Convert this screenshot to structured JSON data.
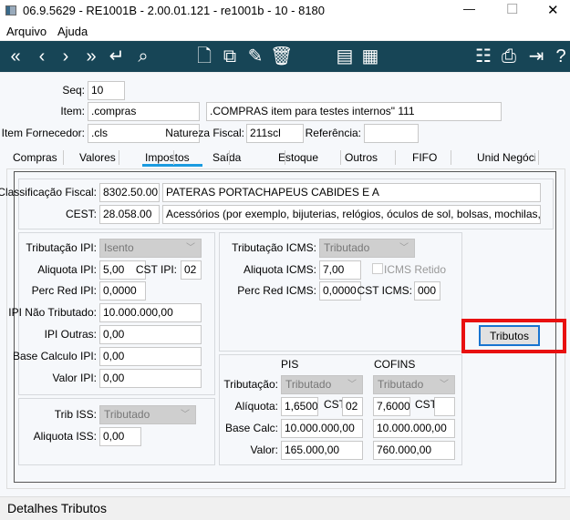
{
  "window": {
    "title": "06.9.5629 - RE1001B - 2.00.01.121 - re1001b - 10 - 8180",
    "minimize": "—",
    "maximize": "☐",
    "close": "✕"
  },
  "menu": [
    "Arquivo",
    "Ajuda"
  ],
  "toolbar": {
    "icons": [
      "first-icon",
      "prev-icon",
      "next-icon",
      "last-icon",
      "go-to-icon",
      "search-icon",
      "new-icon",
      "copy-icon",
      "edit-icon",
      "delete-icon",
      "report-icon",
      "grid-icon",
      "tree-icon",
      "print-icon",
      "exit-icon",
      "help-icon"
    ],
    "glyphs": [
      "«",
      "‹",
      "›",
      "»",
      "↵",
      "⌕",
      "🗋",
      "⧉",
      "✎",
      "🗑",
      "▤",
      "▦",
      "☷",
      "⎙",
      "⇥",
      "?"
    ]
  },
  "header": {
    "seq_label": "Seq:",
    "seq": "10",
    "item_label": "Item:",
    "item": ".compras",
    "item_desc": ".COMPRAS item para testes internos\" 111",
    "fornecedor_label": "Item Fornecedor:",
    "fornecedor": ".cls",
    "natureza_label": "Natureza Fiscal:",
    "natureza": "211scl",
    "referencia_label": "Referência:",
    "referencia": ""
  },
  "tabs": [
    "Compras",
    "Valores",
    "Impostos",
    "Saída",
    "Estoque",
    "Outros",
    "FIFO",
    "Unid Negócio"
  ],
  "active_tab": "Impostos",
  "classificacao": {
    "label": "Classificação Fiscal:",
    "code": "8302.50.00",
    "desc": "PATERAS PORTACHAPEUS CABIDES E A",
    "cest_label": "CEST:",
    "cest": "28.058.00",
    "cest_desc": "Acessórios (por exemplo, bijuterias, relógios, óculos de sol, bolsas, mochilas, ma"
  },
  "ipi": {
    "trib_label": "Tributação IPI:",
    "trib": "Isento",
    "aliq_label": "Aliquota IPI:",
    "aliq": "5,00",
    "cst_label": "CST IPI:",
    "cst": "02",
    "perc_label": "Perc Red IPI:",
    "perc": "0,0000",
    "nao_trib_label": "IPI Não Tributado:",
    "nao_trib": "10.000.000,00",
    "outras_label": "IPI Outras:",
    "outras": "0,00",
    "base_label": "Base Calculo IPI:",
    "base": "0,00",
    "valor_label": "Valor IPI:",
    "valor": "0,00"
  },
  "iss": {
    "trib_label": "Trib ISS:",
    "trib": "Tributado",
    "aliq_label": "Aliquota ISS:",
    "aliq": "0,00"
  },
  "icms": {
    "trib_label": "Tributação ICMS:",
    "trib": "Tributado",
    "aliq_label": "Aliquota ICMS:",
    "aliq": "7,00",
    "retido_label": "ICMS Retido",
    "retido": false,
    "perc_label": "Perc Red ICMS:",
    "perc": "0,0000",
    "cst_label": "CST ICMS:",
    "cst": "000",
    "tributos_button": "Tributos"
  },
  "pis_cofins": {
    "pis_header": "PIS",
    "cofins_header": "COFINS",
    "trib_label": "Tributação:",
    "aliq_label": "Alíquota:",
    "cst_label": "CST:",
    "base_label": "Base Calc:",
    "valor_label": "Valor:",
    "pis": {
      "trib": "Tributado",
      "aliq": "1,6500",
      "cst": "02",
      "base": "10.000.000,00",
      "valor": "165.000,00"
    },
    "cofins": {
      "trib": "Tributado",
      "aliq": "7,6000",
      "cst": "",
      "base": "10.000.000,00",
      "valor": "760.000,00"
    }
  },
  "status": "Detalhes Tributos",
  "colors": {
    "toolbar": "#174556",
    "highlight": "#e81010",
    "tab_underline": "#1a9be0"
  }
}
